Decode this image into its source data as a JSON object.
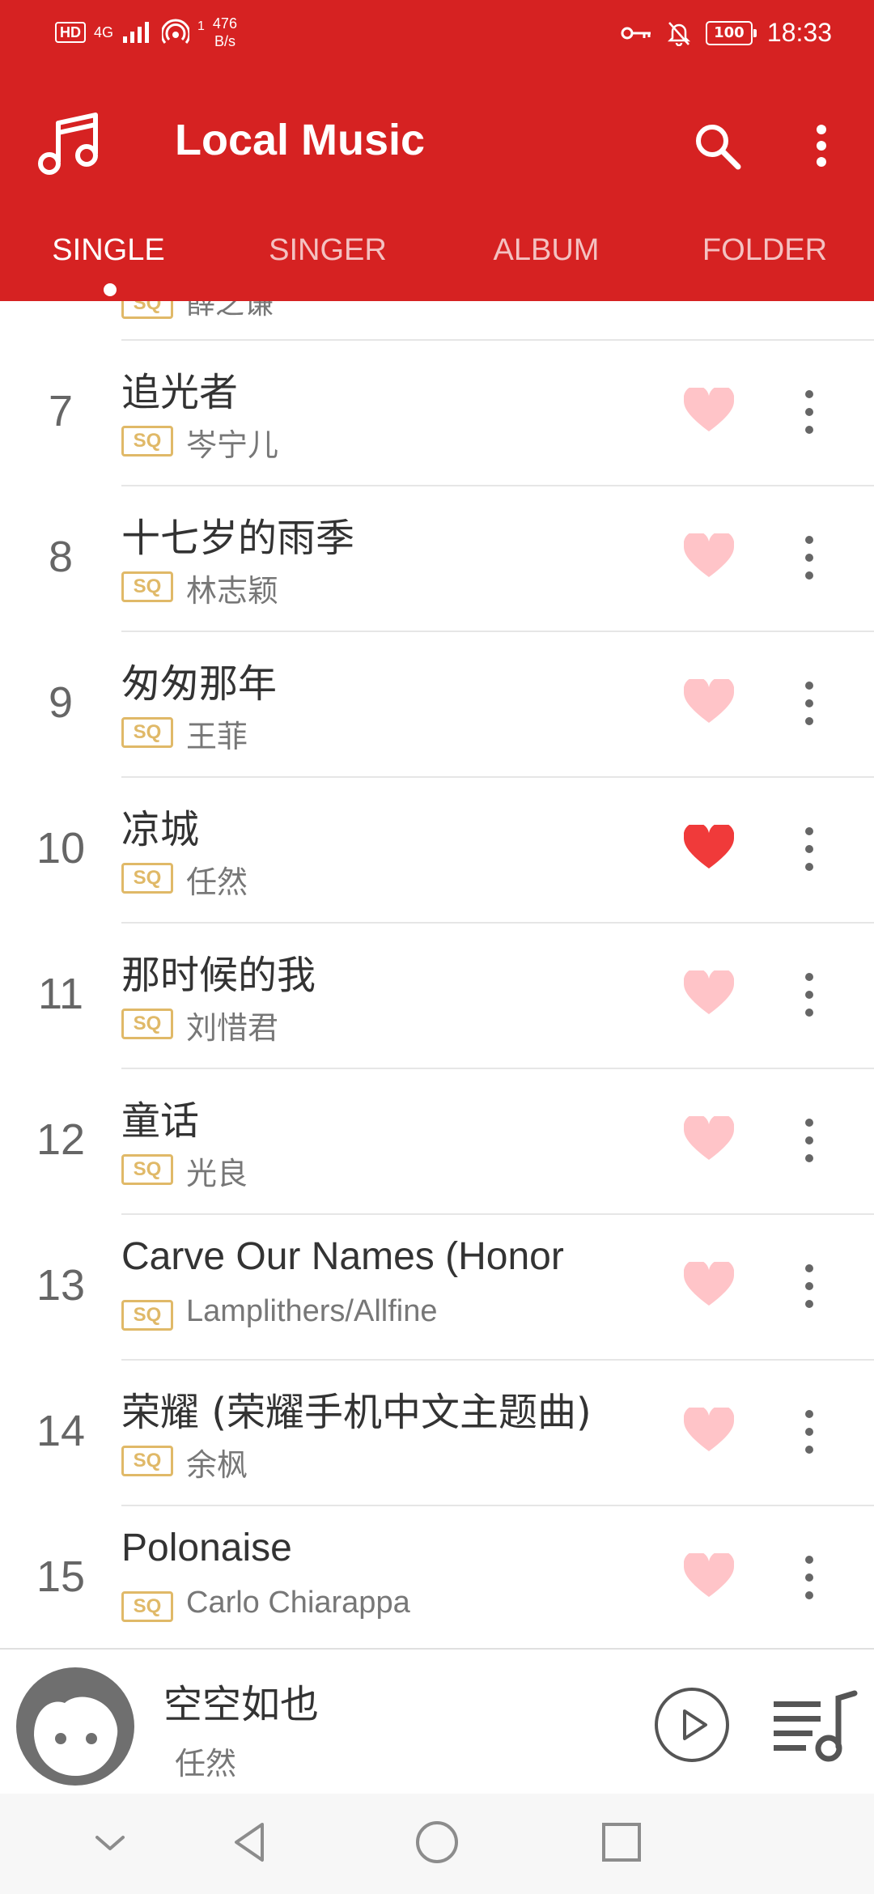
{
  "status_bar": {
    "hd": "HD",
    "network": "4G",
    "speed_top": "476",
    "speed_bottom": "B/s",
    "sup": "1",
    "battery": "100",
    "time": "18:33"
  },
  "toolbar": {
    "title": "Local Music"
  },
  "tabs": [
    {
      "label": "SINGLE",
      "active": true
    },
    {
      "label": "SINGER",
      "active": false
    },
    {
      "label": "ALBUM",
      "active": false
    },
    {
      "label": "FOLDER",
      "active": false
    }
  ],
  "partial_row": {
    "quality": "SQ",
    "artist": "薛之谦"
  },
  "songs": [
    {
      "number": "7",
      "title": "追光者",
      "quality": "SQ",
      "artist": "岑宁儿",
      "favorite": false
    },
    {
      "number": "8",
      "title": "十七岁的雨季",
      "quality": "SQ",
      "artist": "林志颖",
      "favorite": false
    },
    {
      "number": "9",
      "title": "匆匆那年",
      "quality": "SQ",
      "artist": "王菲",
      "favorite": false
    },
    {
      "number": "10",
      "title": "凉城",
      "quality": "SQ",
      "artist": "任然",
      "favorite": true
    },
    {
      "number": "11",
      "title": "那时候的我",
      "quality": "SQ",
      "artist": "刘惜君",
      "favorite": false
    },
    {
      "number": "12",
      "title": "童话",
      "quality": "SQ",
      "artist": "光良",
      "favorite": false
    },
    {
      "number": "13",
      "title": "Carve Our Names (Honor",
      "quality": "SQ",
      "artist": "Lamplithers/Allfine",
      "favorite": false
    },
    {
      "number": "14",
      "title": "荣耀 (荣耀手机中文主题曲)",
      "quality": "SQ",
      "artist": "余枫",
      "favorite": false
    },
    {
      "number": "15",
      "title": "Polonaise",
      "quality": "SQ",
      "artist": "Carlo Chiarappa",
      "favorite": false
    }
  ],
  "now_playing": {
    "title": "空空如也",
    "artist": "任然"
  },
  "colors": {
    "header": "#d62222",
    "heart_active": "#f03a3a",
    "heart_inactive": "#ffc4c8",
    "sq_badge": "#e0b968"
  },
  "icons": {
    "logo": "music-note-icon",
    "search": "search-icon",
    "more": "more-vertical-icon",
    "favorite": "heart-icon",
    "song_more": "more-vertical-icon",
    "play": "play-icon",
    "playlist": "playlist-icon",
    "nav_down": "chevron-down-icon",
    "nav_back": "back-triangle-icon",
    "nav_home": "home-circle-icon",
    "nav_recent": "recent-square-icon"
  }
}
